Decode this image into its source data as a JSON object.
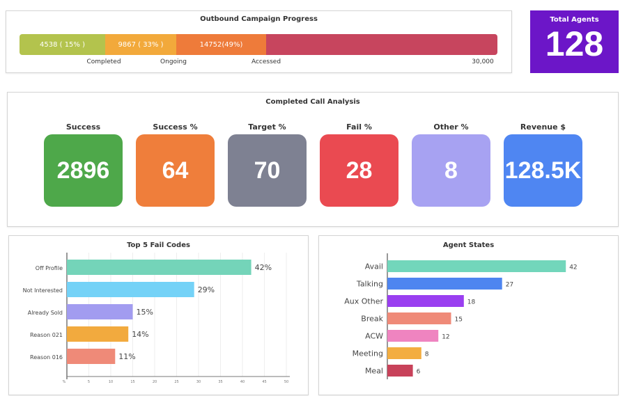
{
  "progress": {
    "title": "Outbound Campaign Progress",
    "segments": [
      {
        "label": "4538 ( 15% )",
        "color": "#b3c34d"
      },
      {
        "label": "9867 ( 33% )",
        "color": "#f2a93b"
      },
      {
        "label": "14752(49%)",
        "color": "#ee7b3a"
      },
      {
        "label": "",
        "color": "#c7455e"
      }
    ],
    "axis_labels": [
      "Completed",
      "Ongoing",
      "Accessed",
      "30,000"
    ]
  },
  "total_agents": {
    "title": "Total Agents",
    "value": "128",
    "color": "#6c16c8"
  },
  "call_analysis": {
    "title": "Completed Call Analysis",
    "tiles": [
      {
        "label": "Success",
        "value": "2896",
        "color": "#4ea84a"
      },
      {
        "label": "Success %",
        "value": "64",
        "color": "#ef7e3b"
      },
      {
        "label": "Target %",
        "value": "70",
        "color": "#7e8192"
      },
      {
        "label": "Fail %",
        "value": "28",
        "color": "#ea4a51"
      },
      {
        "label": "Other %",
        "value": "8",
        "color": "#a7a2f2"
      },
      {
        "label": "Revenue $",
        "value": "128.5K",
        "color": "#4f86f2"
      }
    ]
  },
  "chart_data": [
    {
      "type": "bar",
      "orientation": "horizontal",
      "title": "Top 5 Fail Codes",
      "categories": [
        "Off Profile",
        "Not Interested",
        "Already Sold",
        "Reason 021",
        "Reason 016"
      ],
      "values": [
        42,
        29,
        15,
        14,
        11
      ],
      "value_suffix": "%",
      "colors": [
        "#74d4b9",
        "#74d2f7",
        "#a29cf0",
        "#f2aa3e",
        "#ef8a78"
      ],
      "xlim": [
        0,
        50
      ],
      "xticks": [
        "%",
        "5",
        "10",
        "15",
        "20",
        "25",
        "30",
        "35",
        "40",
        "45",
        "50"
      ],
      "grid": true
    },
    {
      "type": "bar",
      "orientation": "horizontal",
      "title": "Agent States",
      "categories": [
        "Avail",
        "Talking",
        "Aux Other",
        "Break",
        "ACW",
        "Meeting",
        "Meal"
      ],
      "values": [
        42,
        27,
        18,
        15,
        12,
        8,
        6
      ],
      "colors": [
        "#72d6bb",
        "#4e85f0",
        "#9a3ff0",
        "#ef8a78",
        "#ef84c0",
        "#f3ad40",
        "#c8425a"
      ],
      "xlim": [
        0,
        50
      ],
      "grid": false
    }
  ]
}
